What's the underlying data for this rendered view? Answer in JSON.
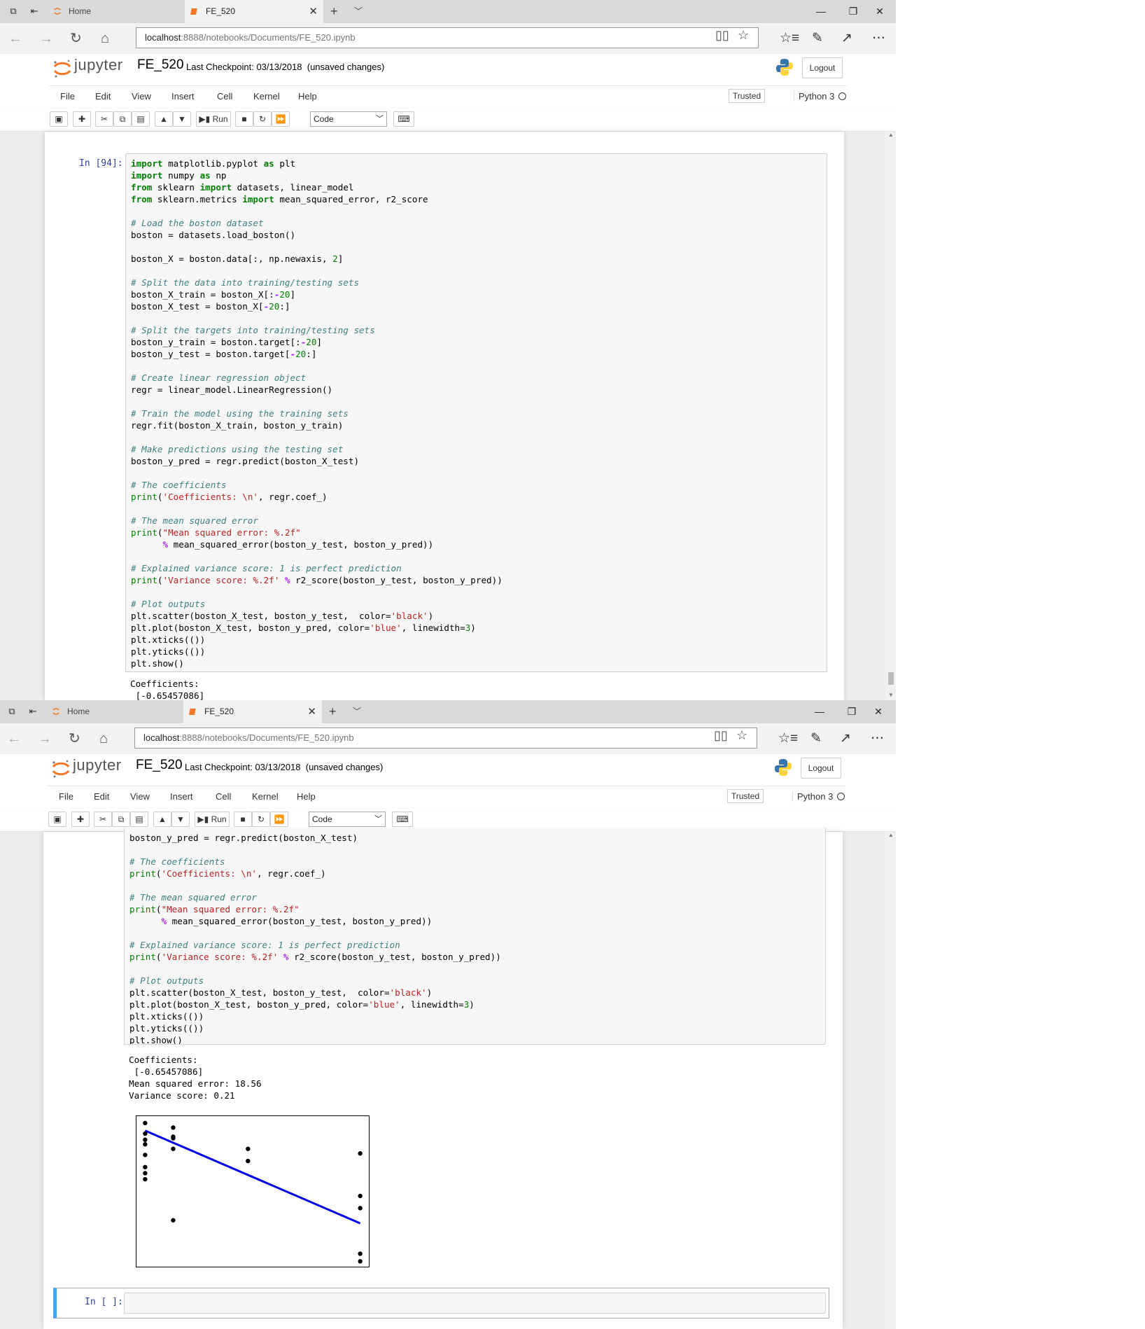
{
  "browser": {
    "tabs": [
      {
        "label": "Home",
        "active": false
      },
      {
        "label": "FE_520",
        "active": true
      }
    ],
    "url_host": "localhost",
    "url_path": ":8888/notebooks/Documents/FE_520.ipynb"
  },
  "jupyter": {
    "logo_text": "jupyter",
    "notebook_name": "FE_520",
    "checkpoint": "Last Checkpoint: 03/13/2018",
    "status": "(unsaved changes)",
    "logout_label": "Logout",
    "menu": [
      "File",
      "Edit",
      "View",
      "Insert",
      "Cell",
      "Kernel",
      "Help"
    ],
    "trusted_label": "Trusted",
    "kernel_label": "Python 3",
    "run_label": "Run",
    "cell_type": "Code"
  },
  "cell": {
    "in_prompt": "In [94]:",
    "empty_prompt": "In [ ]:"
  },
  "output": {
    "line1": "Coefficients:",
    "line2": " [-0.65457086]",
    "line3": "Mean squared error: 18.56",
    "line4": "Variance score: 0.21"
  },
  "colors": {
    "accent": "#f37726",
    "prompt": "#303f9f",
    "line": "#0000ee",
    "selected_cell": "#42a5f5"
  },
  "chart_data": {
    "type": "scatter",
    "ticks": "hidden",
    "xlim": [
      0,
      1
    ],
    "ylim": [
      0,
      1
    ],
    "points": [
      [
        0.04,
        0.95
      ],
      [
        0.04,
        0.88
      ],
      [
        0.04,
        0.84
      ],
      [
        0.04,
        0.81
      ],
      [
        0.04,
        0.74
      ],
      [
        0.04,
        0.66
      ],
      [
        0.04,
        0.62
      ],
      [
        0.04,
        0.58
      ],
      [
        0.16,
        0.92
      ],
      [
        0.16,
        0.86
      ],
      [
        0.16,
        0.85
      ],
      [
        0.16,
        0.78
      ],
      [
        0.16,
        0.31
      ],
      [
        0.48,
        0.78
      ],
      [
        0.48,
        0.7
      ],
      [
        0.96,
        0.75
      ],
      [
        0.96,
        0.47
      ],
      [
        0.96,
        0.39
      ],
      [
        0.96,
        0.09
      ],
      [
        0.96,
        0.04
      ]
    ],
    "line": [
      [
        0.04,
        0.9
      ],
      [
        0.96,
        0.29
      ]
    ],
    "point_color": "black",
    "line_color": "blue"
  }
}
